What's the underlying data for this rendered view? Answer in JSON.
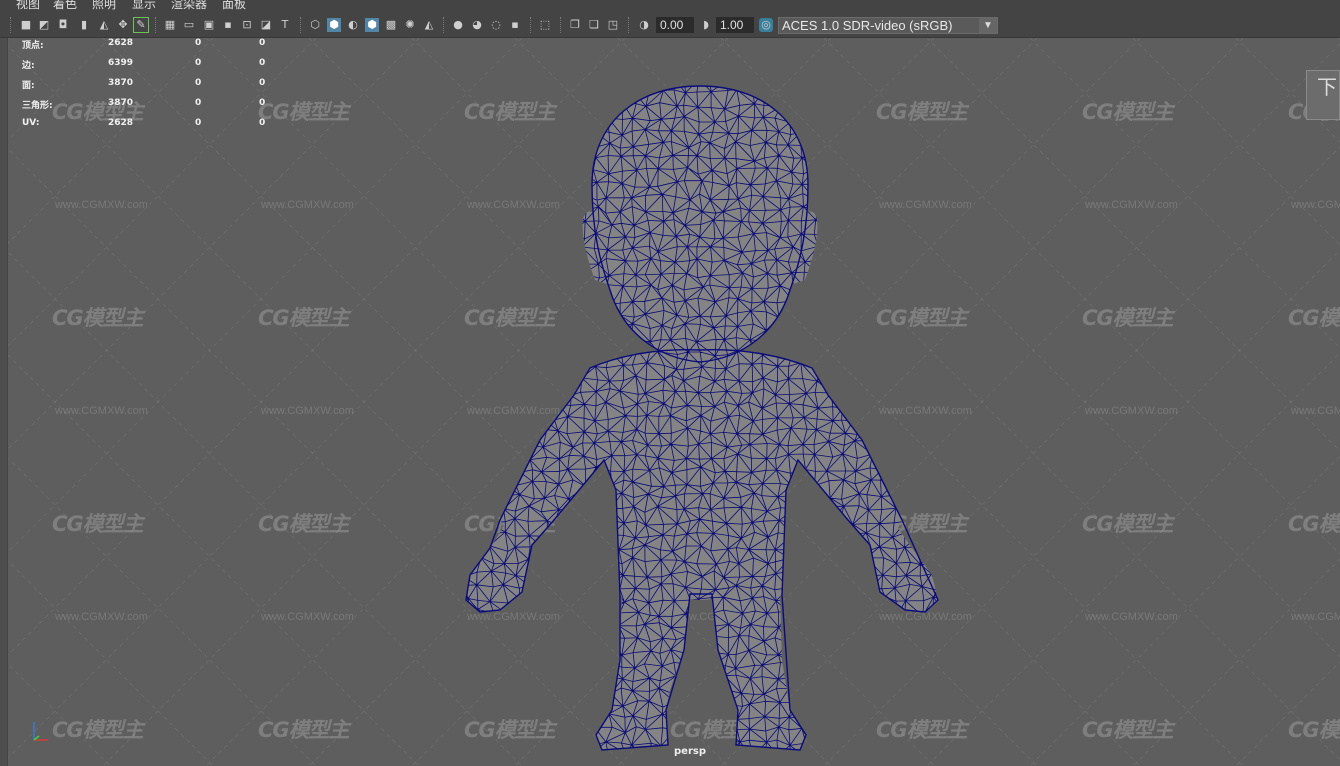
{
  "menu": [
    "视图",
    "着色",
    "照明",
    "显示",
    "渲染器",
    "面板"
  ],
  "toolbar": {
    "field_a": "0.00",
    "field_b": "1.00",
    "color_management": "ACES 1.0 SDR-video (sRGB)"
  },
  "hud": {
    "rows": [
      {
        "label": "顶点:",
        "v1": "2628",
        "v2": "0",
        "v3": "0"
      },
      {
        "label": "边:",
        "v1": "6399",
        "v2": "0",
        "v3": "0"
      },
      {
        "label": "面:",
        "v1": "3870",
        "v2": "0",
        "v3": "0"
      },
      {
        "label": "三角形:",
        "v1": "3870",
        "v2": "0",
        "v3": "0"
      },
      {
        "label": "UV:",
        "v1": "2628",
        "v2": "0",
        "v3": "0"
      }
    ]
  },
  "camera_label": "persp",
  "view_cube_label": "下",
  "watermark": {
    "logo": "CG模型主",
    "url": "www.CGMXW.com"
  },
  "colors": {
    "wire": "#0b0b7a",
    "mesh": "#8a8a8a",
    "viewport": "#5e5e5e"
  }
}
